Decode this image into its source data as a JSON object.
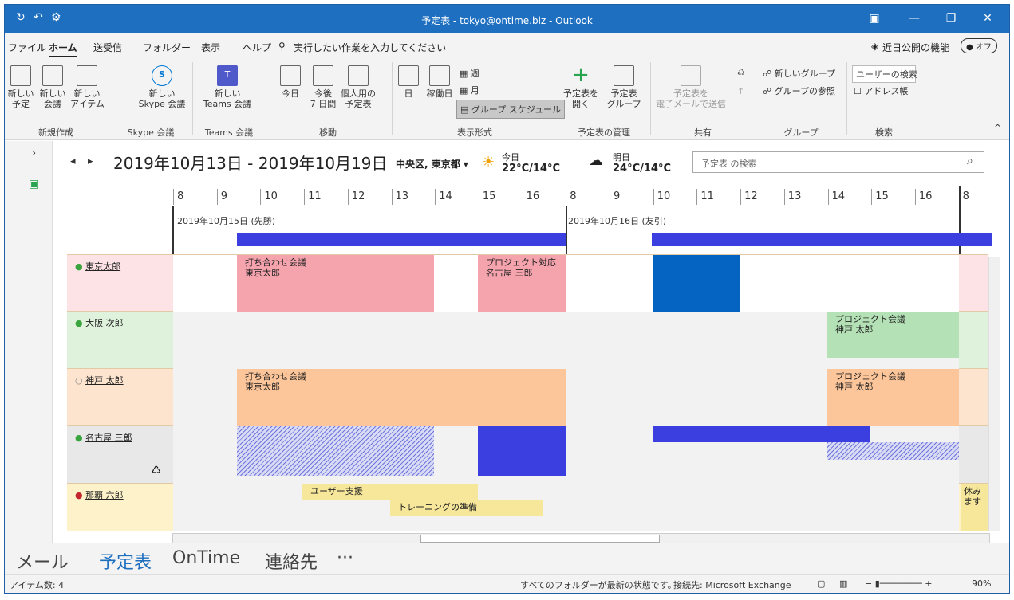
{
  "window": {
    "title": "予定表 - tokyo@ontime.biz - Outlook"
  },
  "menu": {
    "items": [
      "ファイル",
      "ホーム",
      "送受信",
      "フォルダー",
      "表示",
      "ヘルプ"
    ],
    "tell_me": "実行したい作業を入力してください",
    "coming_soon": "近日公開の機能",
    "toggle": "オフ"
  },
  "ribbon": {
    "new_appt": "新しい\n予定",
    "new_meeting": "新しい\n会議",
    "new_items": "新しい\nアイテム",
    "skype": "新しい\nSkype 会議",
    "teams": "新しい\nTeams 会議",
    "today": "今日",
    "next7": "今後\n7 日間",
    "personal": "個人用の\n予定表",
    "day": "日",
    "workweek": "稼働日",
    "week": "週",
    "month": "月",
    "group_schedule": "グループ スケジュール",
    "open_cal": "予定表を\n開く",
    "cal_groups": "予定表\nグループ",
    "email_cal": "予定表を\n電子メールで送信",
    "new_group": "新しいグループ",
    "browse_groups": "グループの参照",
    "user_search": "ユーザーの検索",
    "address_book": "アドレス帳",
    "groups": {
      "new": "新規作成",
      "skype": "Skype 会議",
      "teams": "Teams 会議",
      "goto": "移動",
      "arrange": "表示形式",
      "manage": "予定表の管理",
      "share": "共有",
      "group": "グループ",
      "find": "検索"
    }
  },
  "calendar": {
    "date_range": "2019年10月13日 - 2019年10月19日",
    "location": "中央区, 東京都",
    "today_label": "今日",
    "today_temp": "22°C/14°C",
    "tomorrow_label": "明日",
    "tomorrow_temp": "24°C/14°C",
    "search_placeholder": "予定表 の検索",
    "day1": "2019年10月15日 (先勝)",
    "day2": "2019年10月16日 (友引)"
  },
  "hours": [
    "8",
    "9",
    "10",
    "11",
    "12",
    "13",
    "14",
    "15",
    "16",
    "8",
    "9",
    "10",
    "11",
    "12",
    "13",
    "14",
    "15",
    "16",
    "8"
  ],
  "people": [
    {
      "name": "東京太郎"
    },
    {
      "name": "大阪 次郎"
    },
    {
      "name": "神戸 太郎"
    },
    {
      "name": "名古屋 三郎"
    },
    {
      "name": "那覇 六郎"
    }
  ],
  "events": {
    "meeting_title": "打ち合わせ会議",
    "meeting_owner": "東京太郎",
    "proj_title": "プロジェクト対応",
    "proj_owner": "名古屋 三郎",
    "proj_meeting": "プロジェクト会議",
    "proj_meeting_owner": "神戸 太郎",
    "support": "ユーザー支援",
    "training": "トレーニングの準備",
    "holiday": "休みます"
  },
  "nav": {
    "mail": "メール",
    "calendar": "予定表",
    "ontime": "OnTime",
    "contacts": "連絡先",
    "more": "···"
  },
  "status": {
    "items": "アイテム数: 4",
    "sync": "すべてのフォルダーが最新の状態です。",
    "connection": "接続先: Microsoft Exchange",
    "zoom": "90%"
  },
  "colors": {
    "accent": "#1e6fc0",
    "busy_blue": "#3b3fe0",
    "pink": "#f5a3ad",
    "orange": "#fdc69a",
    "green": "#b4e2b6",
    "yellow": "#f7e79a"
  }
}
